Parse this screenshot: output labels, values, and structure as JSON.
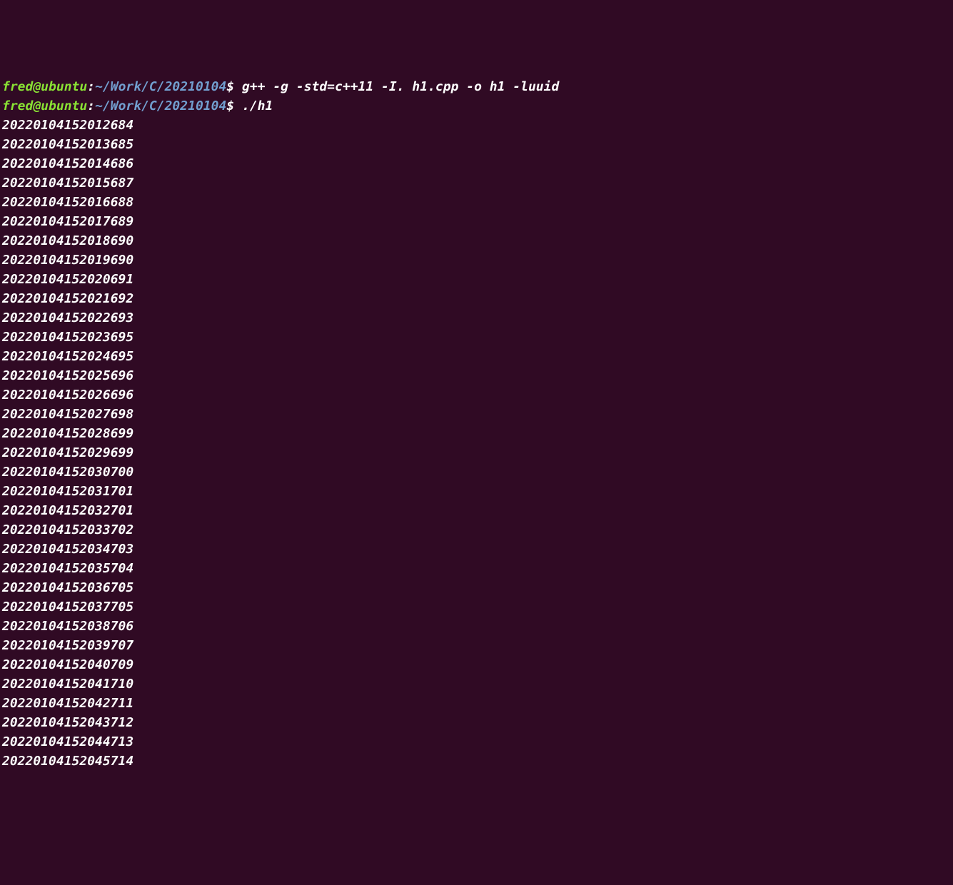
{
  "terminal": {
    "prompts": [
      {
        "user": "fred@ubuntu",
        "colon": ":",
        "path": "~/Work/C/20210104",
        "dollar": "$",
        "command": " g++ -g -std=c++11 -I. h1.cpp -o h1 -luuid"
      },
      {
        "user": "fred@ubuntu",
        "colon": ":",
        "path": "~/Work/C/20210104",
        "dollar": "$",
        "command": " ./h1"
      }
    ],
    "output": [
      "20220104152012684",
      "20220104152013685",
      "20220104152014686",
      "20220104152015687",
      "20220104152016688",
      "20220104152017689",
      "20220104152018690",
      "20220104152019690",
      "20220104152020691",
      "20220104152021692",
      "20220104152022693",
      "20220104152023695",
      "20220104152024695",
      "20220104152025696",
      "20220104152026696",
      "20220104152027698",
      "20220104152028699",
      "20220104152029699",
      "20220104152030700",
      "20220104152031701",
      "20220104152032701",
      "20220104152033702",
      "20220104152034703",
      "20220104152035704",
      "20220104152036705",
      "20220104152037705",
      "20220104152038706",
      "20220104152039707",
      "20220104152040709",
      "20220104152041710",
      "20220104152042711",
      "20220104152043712",
      "20220104152044713",
      "20220104152045714"
    ]
  }
}
